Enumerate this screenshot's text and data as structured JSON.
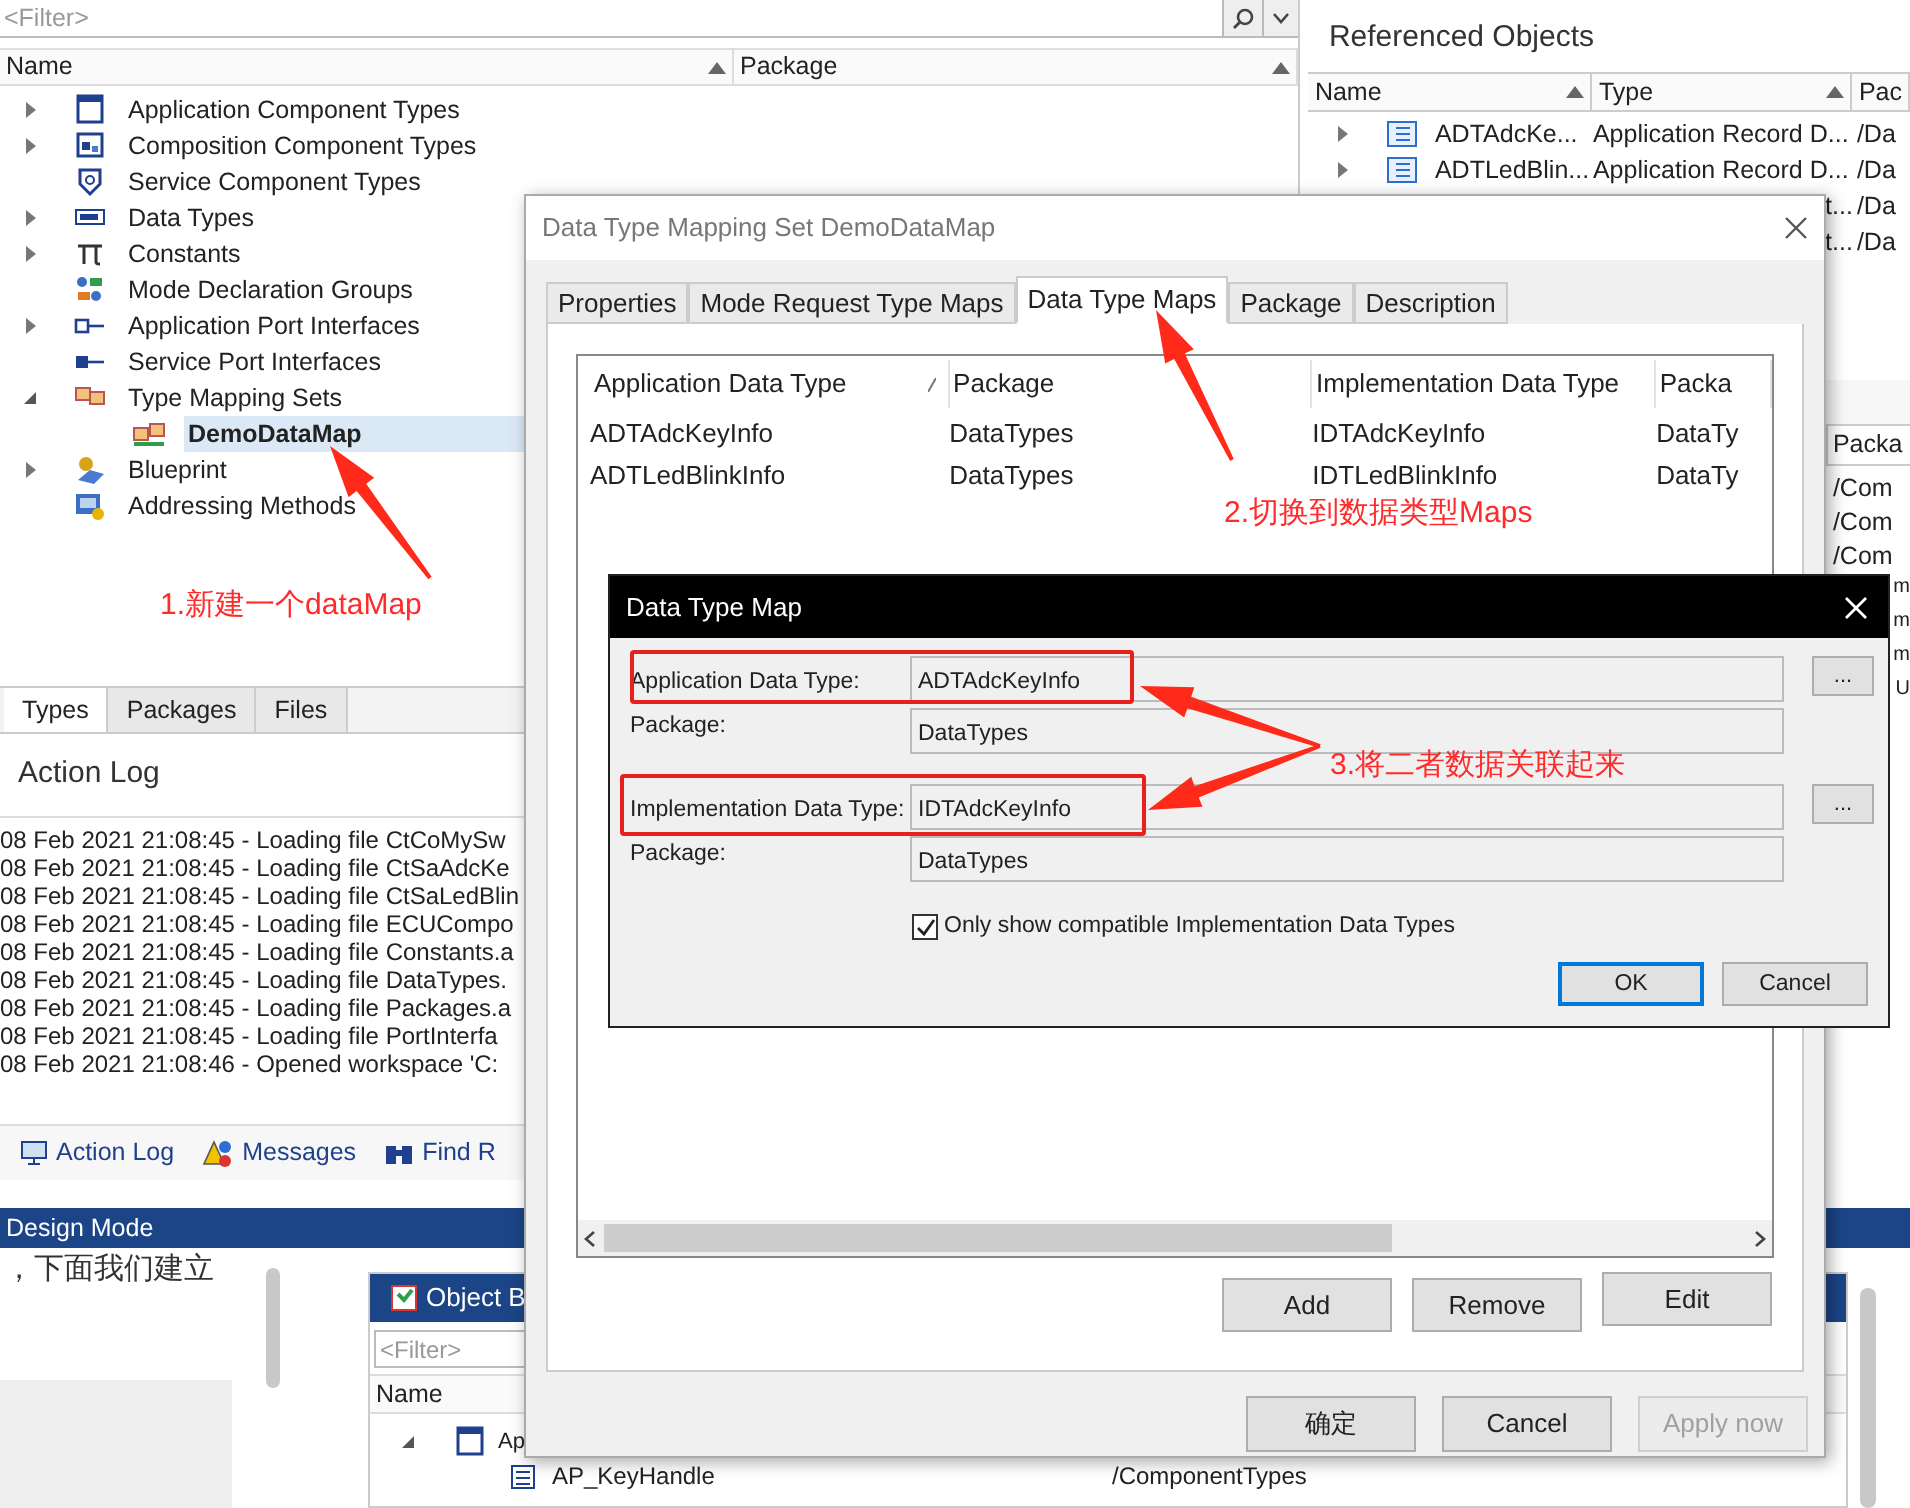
{
  "filter": {
    "placeholder": "<Filter>"
  },
  "tree": {
    "columns": [
      "Name",
      "Package"
    ],
    "items": [
      {
        "label": "Application Component Types",
        "expanded": false,
        "selected": false
      },
      {
        "label": "Composition Component Types",
        "expanded": false,
        "selected": false
      },
      {
        "label": "Service Component Types",
        "selected": false
      },
      {
        "label": "Data Types",
        "expanded": false,
        "selected": false
      },
      {
        "label": "Constants",
        "expanded": false,
        "selected": false
      },
      {
        "label": "Mode Declaration Groups",
        "selected": false
      },
      {
        "label": "Application Port Interfaces",
        "expanded": false,
        "selected": false
      },
      {
        "label": "Service Port Interfaces",
        "selected": false
      },
      {
        "label": "Type Mapping Sets",
        "expanded": true,
        "selected": false,
        "children": [
          {
            "label": "DemoDataMap",
            "selected": true
          }
        ]
      },
      {
        "label": "Blueprint",
        "expanded": false,
        "selected": false
      },
      {
        "label": "Addressing Methods",
        "selected": false
      }
    ]
  },
  "view_tabs": [
    {
      "label": "Types",
      "selected": true
    },
    {
      "label": "Packages",
      "selected": false
    },
    {
      "label": "Files",
      "selected": false
    }
  ],
  "action_log": {
    "title": "Action Log",
    "lines": [
      "08 Feb 2021 21:08:45 - Loading file CtCoMySw",
      "08 Feb 2021 21:08:45 - Loading file CtSaAdcKe",
      "08 Feb 2021 21:08:45 - Loading file CtSaLedBlin",
      "08 Feb 2021 21:08:45 - Loading file ECUCompo",
      "08 Feb 2021 21:08:45 - Loading file Constants.a",
      "08 Feb 2021 21:08:45 - Loading file DataTypes.",
      "08 Feb 2021 21:08:45 - Loading file Packages.a",
      "08 Feb 2021 21:08:45 - Loading file PortInterfa",
      "08 Feb 2021 21:08:46 - Opened workspace 'C:"
    ]
  },
  "dock_tabs": [
    "Action Log",
    "Messages",
    "Find R"
  ],
  "status_bar": "Design Mode",
  "referenced_objects": {
    "title": "Referenced Objects",
    "columns": [
      "Name",
      "Type",
      "Pac"
    ],
    "rows": [
      {
        "name": "ADTAdcKe...",
        "type": "Application Record D...",
        "package": "/Da"
      },
      {
        "name": "ADTLedBlin...",
        "type": "Application Record D...",
        "package": "/Da"
      },
      {
        "type": "t...",
        "package": "/Da"
      },
      {
        "type": "t...",
        "package": "/Da"
      }
    ]
  },
  "lower_panel": {
    "column": "Packa",
    "cells": [
      "/Com",
      "/Com",
      "/Com"
    ],
    "clipped_cells": [
      "m",
      "m",
      "m",
      "U"
    ]
  },
  "article_text": "，下面我们建立",
  "object_browser": {
    "title": "Object B",
    "filter_placeholder": "<Filter>",
    "column": "Name",
    "items": [
      {
        "label": "Ap",
        "expanded": true,
        "children": [
          {
            "label": "AP_KeyHandle",
            "package": "/ComponentTypes"
          }
        ]
      }
    ]
  },
  "mapping_dialog": {
    "title": "Data Type Mapping Set DemoDataMap",
    "tabs": [
      {
        "label": "Properties",
        "selected": false
      },
      {
        "label": "Mode Request Type Maps",
        "selected": false
      },
      {
        "label": "Data Type Maps",
        "selected": true
      },
      {
        "label": "Package",
        "selected": false
      },
      {
        "label": "Description",
        "selected": false
      }
    ],
    "table": {
      "columns": [
        "Application Data Type",
        "Package",
        "Implementation Data Type",
        "Packa"
      ],
      "rows": [
        [
          "ADTAdcKeyInfo",
          "DataTypes",
          "IDTAdcKeyInfo",
          "DataTy"
        ],
        [
          "ADTLedBlinkInfo",
          "DataTypes",
          "IDTLedBlinkInfo",
          "DataTy"
        ]
      ]
    },
    "buttons": [
      "Add",
      "Remove",
      "Edit"
    ],
    "footer_buttons": [
      {
        "label": "确定",
        "disabled": false
      },
      {
        "label": "Cancel",
        "disabled": false
      },
      {
        "label": "Apply now",
        "disabled": true
      }
    ]
  },
  "map_dialog": {
    "title": "Data Type Map",
    "fields": [
      {
        "label": "Application Data Type:",
        "value": "ADTAdcKeyInfo",
        "kind": "browse",
        "highlighted": true
      },
      {
        "label": "Package:",
        "value": "DataTypes",
        "kind": "plain",
        "highlighted": false
      },
      {
        "label": "Implementation Data Type:",
        "value": "IDTAdcKeyInfo",
        "kind": "browse",
        "highlighted": true
      },
      {
        "label": "Package:",
        "value": "DataTypes",
        "kind": "plain",
        "highlighted": false
      }
    ],
    "browse_label": "...",
    "checkbox": {
      "label": "Only show compatible Implementation Data Types",
      "checked": true
    },
    "buttons": [
      {
        "label": "OK",
        "default": true
      },
      {
        "label": "Cancel",
        "default": false
      }
    ]
  },
  "annotations": [
    {
      "text": "1.新建一个dataMap"
    },
    {
      "text": "2.切换到数据类型Maps"
    },
    {
      "text": "3.将二者数据关联起来"
    }
  ]
}
